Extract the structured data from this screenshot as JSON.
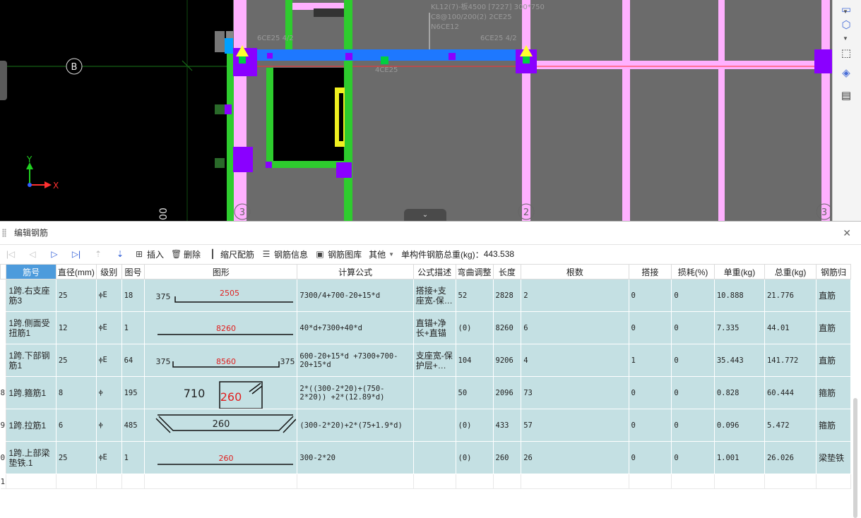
{
  "viewport": {
    "annotations": {
      "beam_line1": "KL12(7)-板4500 [7227] 300*750",
      "beam_line2": "C8@100/200(2) 2CE25",
      "beam_line3": "N6CE12",
      "top_left_rebar": "6CE25 4/2",
      "top_right_rebar": "6CE25 4/2",
      "bottom_rebar": "4CE25"
    },
    "axis_labels": {
      "row_b": "B",
      "col_3a": "3",
      "col_2": "2",
      "col_3b": "3"
    },
    "coord_axes": {
      "x": "X",
      "y": "Y"
    },
    "cut_text": "00",
    "colors": {
      "background": "#000000",
      "beam": "#1e78ff",
      "column": "#8a00ff",
      "wall": "#2ecc2e",
      "slab": "#6b6b6b",
      "gridline": "#ffb0ff"
    }
  },
  "panel": {
    "title": "编辑钢筋",
    "close_icon": "close-icon"
  },
  "toolbar": {
    "insert": "插入",
    "delete": "删除",
    "scale_rebar": "缩尺配筋",
    "rebar_info": "钢筋信息",
    "rebar_library": "钢筋图库",
    "other": "其他",
    "total_weight_label": "单构件钢筋总重(kg)：",
    "total_weight_value": "443.538"
  },
  "table": {
    "headers": [
      "筋号",
      "直径(mm)",
      "级别",
      "图号",
      "图形",
      "计算公式",
      "公式描述",
      "弯曲调整",
      "长度",
      "根数",
      "搭接",
      "损耗(%)",
      "单重(kg)",
      "总重(kg)",
      "钢筋归"
    ],
    "rows": [
      {
        "row_no": "",
        "name": "1跨.右支座筋3",
        "diameter": "25",
        "grade": "ⲫE",
        "shape_no": "18",
        "shape": {
          "left": "375",
          "main": "2505",
          "right": ""
        },
        "formula": "7300/4+700-20+15*d",
        "description": "搭接+支座宽-保…",
        "bend_adj": "52",
        "length": "2828",
        "count": "2",
        "lap": "0",
        "loss": "0",
        "unit_weight": "10.888",
        "total_weight": "21.776",
        "category": "直筋"
      },
      {
        "row_no": "",
        "name": "1跨.侧面受扭筋1",
        "diameter": "12",
        "grade": "ⲫE",
        "shape_no": "1",
        "shape": {
          "left": "",
          "main": "8260",
          "right": ""
        },
        "formula": "40*d+7300+40*d",
        "description": "直锚+净长+直锚",
        "bend_adj": "(0)",
        "length": "8260",
        "count": "6",
        "lap": "0",
        "loss": "0",
        "unit_weight": "7.335",
        "total_weight": "44.01",
        "category": "直筋"
      },
      {
        "row_no": "",
        "name": "1跨.下部钢筋1",
        "diameter": "25",
        "grade": "ⲫE",
        "shape_no": "64",
        "shape": {
          "left": "375",
          "main": "8560",
          "right": "375"
        },
        "formula": "600-20+15*d +7300+700-20+15*d",
        "description": "支座宽-保护层+…",
        "bend_adj": "104",
        "length": "9206",
        "count": "4",
        "lap": "1",
        "loss": "0",
        "unit_weight": "35.443",
        "total_weight": "141.772",
        "category": "直筋"
      },
      {
        "row_no": "8",
        "name": "1跨.箍筋1",
        "diameter": "8",
        "grade": "ⲫ",
        "shape_no": "195",
        "shape": {
          "left": "710",
          "main": "260",
          "right": ""
        },
        "formula": "2*((300-2*20)+(750-2*20)) +2*(12.89*d)",
        "description": "",
        "bend_adj": "50",
        "length": "2096",
        "count": "73",
        "lap": "0",
        "loss": "0",
        "unit_weight": "0.828",
        "total_weight": "60.444",
        "category": "箍筋"
      },
      {
        "row_no": "9",
        "name": "1跨.拉筋1",
        "diameter": "6",
        "grade": "ⲫ",
        "shape_no": "485",
        "shape": {
          "left": "",
          "main": "260",
          "right": ""
        },
        "formula": "(300-2*20)+2*(75+1.9*d)",
        "description": "",
        "bend_adj": "(0)",
        "length": "433",
        "count": "57",
        "lap": "0",
        "loss": "0",
        "unit_weight": "0.096",
        "total_weight": "5.472",
        "category": "箍筋"
      },
      {
        "row_no": "0",
        "name": "1跨.上部梁垫铁.1",
        "diameter": "25",
        "grade": "ⲫE",
        "shape_no": "1",
        "shape": {
          "left": "",
          "main": "260",
          "right": ""
        },
        "formula": "300-2*20",
        "description": "",
        "bend_adj": "(0)",
        "length": "260",
        "count": "26",
        "lap": "0",
        "loss": "0",
        "unit_weight": "1.001",
        "total_weight": "26.026",
        "category": "梁垫铁"
      }
    ],
    "empty_row_no": "1"
  }
}
